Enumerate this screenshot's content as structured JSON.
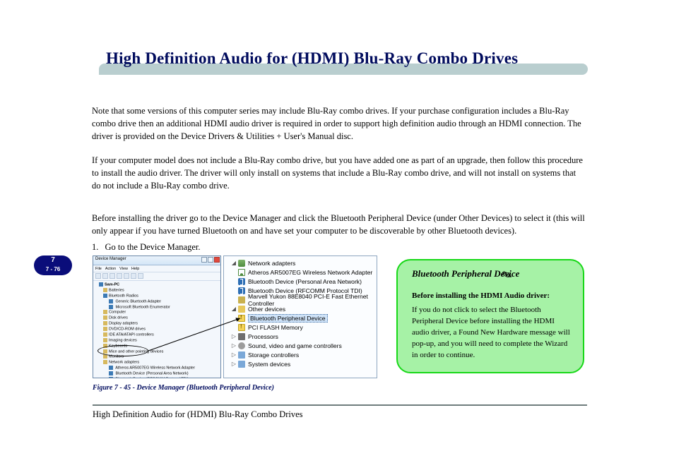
{
  "header": {
    "title": "High Definition Audio for (HDMI) Blu-Ray Combo Drives"
  },
  "paragraphs": {
    "p1": "Note that some versions of this computer series may include Blu-Ray combo drives. If your purchase configuration includes a Blu-Ray combo drive then an additional HDMI audio driver is required in order to support high definition audio through an HDMI connection. The driver is provided on the Device Drivers & Utilities + User's Manual disc.",
    "p2": "If your computer model does not include a Blu-Ray combo drive, but you have added one as part of an upgrade, then follow this procedure to install the audio driver. The driver will only install on systems that include a Blu-Ray combo drive, and will not install on systems that do not include a Blu-Ray combo drive.",
    "p3": "Before installing the driver go to the Device Manager and click the Bluetooth Peripheral Device (under Other Devices) to select it (this will only appear if you have turned Bluetooth on and have set your computer to be discoverable by other Bluetooth devices)."
  },
  "step": {
    "num": "1.",
    "text": "Go to the Device Manager."
  },
  "page": {
    "num": "7 - 76",
    "section": "7"
  },
  "shot_left": {
    "title": "Device Manager",
    "menus": [
      "File",
      "Action",
      "View",
      "Help"
    ],
    "tree_root": "Sam-PC",
    "items": [
      "Batteries",
      "Bluetooth Radios",
      "  Generic Bluetooth Adapter",
      "  Microsoft Bluetooth Enumerator",
      "Computer",
      "Disk drives",
      "Display adapters",
      "DVD/CD-ROM drives",
      "IDE ATA/ATAPI controllers",
      "Imaging devices",
      "Keyboards",
      "Mice and other pointing devices",
      "Monitors",
      "Network adapters",
      "  Atheros AR5007EG Wireless Network Adapter",
      "  Bluetooth Device (Personal Area Network)",
      "  Bluetooth Device (RFCOMM Protocol TDI)",
      "Other devices",
      "  Bluetooth Peripheral Device",
      "Processors",
      "Sound, video and game controllers",
      "Storage controllers",
      "System devices"
    ]
  },
  "shot_right": {
    "cat1": "Network adapters",
    "na1": "Atheros AR5007EG Wireless Network Adapter",
    "na2": "Bluetooth Device (Personal Area Network)",
    "na3": "Bluetooth Device (RFCOMM Protocol TDI)",
    "na4": "Marvell Yukon 88E8040 PCI-E Fast Ethernet Controller",
    "cat2": "Other devices",
    "od1": "Bluetooth Peripheral Device",
    "od2": "PCI FLASH Memory",
    "cat3": "Processors",
    "cat4": "Sound, video and game controllers",
    "cat5": "Storage controllers",
    "cat6": "System devices"
  },
  "note": {
    "pen": "✎",
    "heading": "Bluetooth Peripheral Device",
    "sub": "Before installing the HDMI Audio driver:",
    "body": "If you do not click to select the Bluetooth Peripheral Device before installing the HDMI audio driver, a Found New Hardware message will pop-up, and you will need to complete the Wizard in order to continue."
  },
  "figure": {
    "caption": "Figure 7 - 45 - Device Manager (Bluetooth Peripheral Device)"
  },
  "footer": {
    "text": "High Definition Audio for (HDMI) Blu-Ray Combo Drives"
  }
}
